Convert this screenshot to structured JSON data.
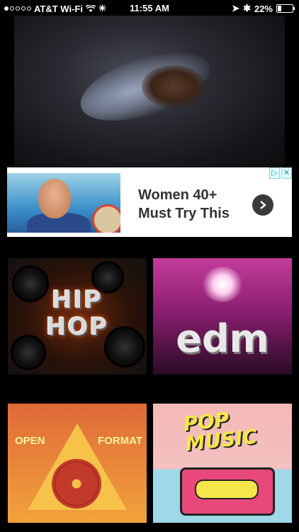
{
  "status_bar": {
    "carrier": "AT&T Wi-Fi",
    "time": "11:55 AM",
    "battery": "22%",
    "battery_level": 0.22
  },
  "ad": {
    "title_line1": "Women 40+",
    "title_line2": "Must Try This"
  },
  "tiles": {
    "hiphop_line1": "HIP",
    "hiphop_line2": "HOP",
    "edm": "edm",
    "open_left": "OPEN",
    "open_right": "FORMAT",
    "pop_line1": "POP",
    "pop_line2": "MUSIC"
  },
  "colors": {
    "background": "#000000",
    "ad_background": "#ffffff",
    "edm_pink": "#c43c9a",
    "open_orange": "#e06a38",
    "pop_yellow": "#f7e64a"
  }
}
